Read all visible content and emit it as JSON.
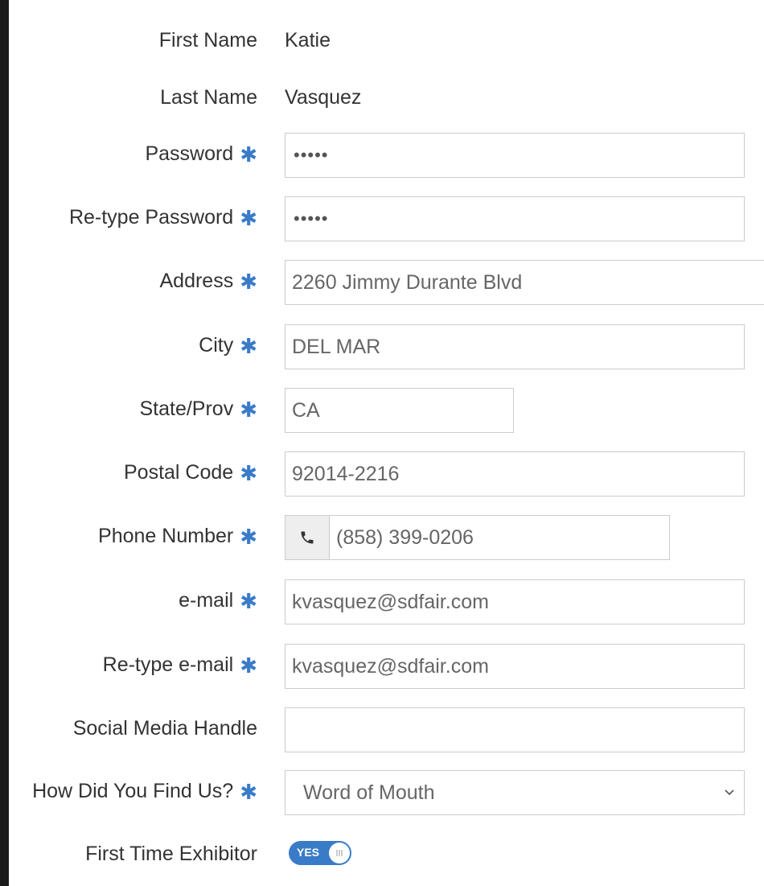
{
  "form": {
    "first_name": {
      "label": "First Name",
      "value": "Katie"
    },
    "last_name": {
      "label": "Last Name",
      "value": "Vasquez"
    },
    "password": {
      "label": "Password",
      "value": "•••••"
    },
    "retype_password": {
      "label": "Re-type Password",
      "value": "•••••"
    },
    "address": {
      "label": "Address",
      "value": "2260 Jimmy Durante Blvd"
    },
    "city": {
      "label": "City",
      "value": "DEL MAR"
    },
    "state": {
      "label": "State/Prov",
      "value": "CA"
    },
    "postal_code": {
      "label": "Postal Code",
      "value": "92014-2216"
    },
    "phone": {
      "label": "Phone Number",
      "value": "(858) 399-0206",
      "icon": "phone-icon"
    },
    "email": {
      "label": "e-mail",
      "value": "kvasquez@sdfair.com"
    },
    "retype_email": {
      "label": "Re-type e-mail",
      "value": "kvasquez@sdfair.com"
    },
    "social": {
      "label": "Social Media Handle",
      "value": ""
    },
    "how_found": {
      "label": "How Did You Find Us?",
      "selected": "Word of Mouth"
    },
    "first_time": {
      "label": "First Time Exhibitor",
      "toggle_text": "YES",
      "state": true
    }
  },
  "colors": {
    "accent": "#3a7bc8",
    "border": "#cccccc",
    "label": "#333333",
    "value": "#666666"
  },
  "required_marker": "✱"
}
